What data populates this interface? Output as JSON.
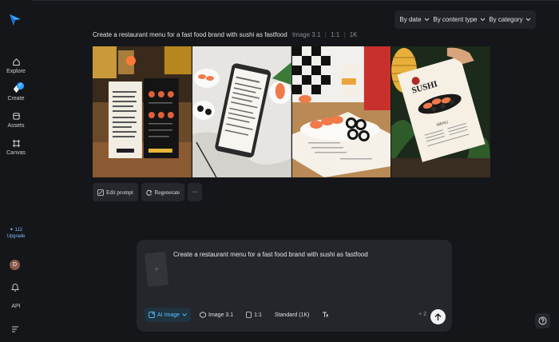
{
  "sidebar": {
    "items": [
      {
        "label": "Explore",
        "icon": "home-icon"
      },
      {
        "label": "Create",
        "icon": "create-icon"
      },
      {
        "label": "Assets",
        "icon": "assets-icon"
      },
      {
        "label": "Canvas",
        "icon": "canvas-icon"
      }
    ],
    "credits": "✦ 112",
    "upgrade_label": "Upgrade",
    "avatar_initial": "D",
    "api_label": "API"
  },
  "filters": {
    "date": "By date",
    "content_type": "By content type",
    "category": "By category"
  },
  "generation": {
    "prompt": "Create a restaurant menu for a fast food brand with sushi as fastfood",
    "model": "Image 3.1",
    "ratio": "1:1",
    "resolution": "1K"
  },
  "actions": {
    "edit_prompt": "Edit prompt",
    "regenerate": "Regenerate",
    "more": "···"
  },
  "composer": {
    "text": "Create a restaurant menu for a fast food brand with sushi as fastfood",
    "ai_mode": "AI Image",
    "model": "Image 3.1",
    "ratio": "1:1",
    "quality": "Standard (1K)",
    "count": "+ 2"
  },
  "image_texts": {
    "img4_brand": "SUSHI",
    "img4_menu": "MENU"
  },
  "colors": {
    "background": "#151619",
    "panel": "#25262b",
    "accent": "#2fa4ff"
  }
}
